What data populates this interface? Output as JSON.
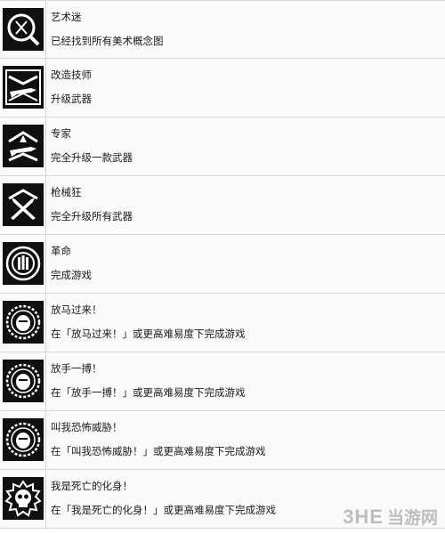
{
  "achievements": [
    {
      "icon": "magnifier-brush-icon",
      "title": "艺术迷",
      "desc": "已经找到所有美术概念图"
    },
    {
      "icon": "chevron-rifle-icon",
      "title": "改造技师",
      "desc": "升级武器"
    },
    {
      "icon": "rank-rifle-icon",
      "title": "专家",
      "desc": "完全升级一款武器"
    },
    {
      "icon": "crossed-rifles-icon",
      "title": "枪械狂",
      "desc": "完全升级所有武器"
    },
    {
      "icon": "fist-emblem-icon",
      "title": "革命",
      "desc": "完成游戏"
    },
    {
      "icon": "face-emblem-icon",
      "title": "放马过来！",
      "desc": "在「放马过来！」或更高难易度下完成游戏"
    },
    {
      "icon": "face-emblem-icon",
      "title": "放手一搏！",
      "desc": "在「放手一搏！」或更高难易度下完成游戏"
    },
    {
      "icon": "face-emblem-icon",
      "title": "叫我恐怖威胁！",
      "desc": "在「叫我恐怖威胁！」或更高难易度下完成游戏"
    },
    {
      "icon": "skull-emblem-icon",
      "title": "我是死亡的化身！",
      "desc": "在「我是死亡的化身！」或更高难易度下完成游戏"
    }
  ],
  "watermark": {
    "brand": "3HE",
    "site": "当游网"
  }
}
